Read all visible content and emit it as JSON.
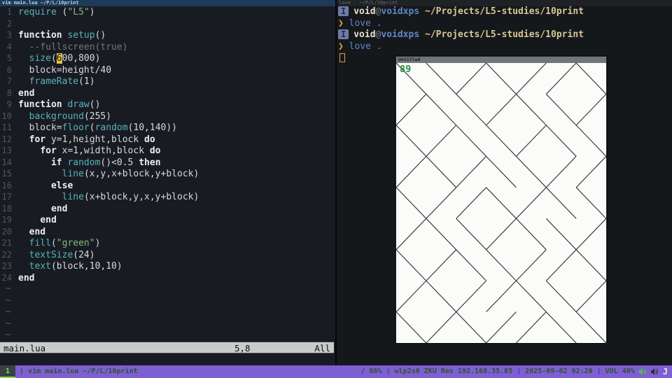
{
  "tmux": {
    "left_pane_title": "vim main.lua ~/P/L/10print",
    "right_pane_title": "love .  ~/P/L/10print",
    "status_bar": {
      "window_index": "1",
      "window_name": "| vim main.lua ~/P/L/10print",
      "right_segments": [
        {
          "text": "/ 86%",
          "sep": false
        },
        {
          "text": "|",
          "sep": true
        },
        {
          "text": "wlp2s0 ZKU Res 192.168.35.85",
          "sep": false
        },
        {
          "text": "|",
          "sep": true
        },
        {
          "text": "2025-09-02 02:20",
          "sep": false
        },
        {
          "text": "|",
          "sep": true
        },
        {
          "text": "VOL 40%",
          "sep": false
        }
      ],
      "icons": [
        "volume-on-icon",
        "volume-muted-icon"
      ],
      "logo": "J"
    }
  },
  "vim": {
    "lines": [
      {
        "n": "1",
        "seg": [
          [
            "f",
            "require"
          ],
          [
            "n",
            " ("
          ],
          [
            "s",
            "\"L5\""
          ],
          [
            "n",
            ")"
          ]
        ]
      },
      {
        "n": "2",
        "seg": []
      },
      {
        "n": "3",
        "seg": [
          [
            "k",
            "function"
          ],
          [
            "n",
            " "
          ],
          [
            "f",
            "setup"
          ],
          [
            "n",
            "()"
          ]
        ]
      },
      {
        "n": "4",
        "seg": [
          [
            "c",
            "  --fullscreen(true)"
          ]
        ]
      },
      {
        "n": "5",
        "seg": [
          [
            "n",
            "  "
          ],
          [
            "f",
            "size"
          ],
          [
            "n",
            "("
          ],
          [
            "cur",
            "6"
          ],
          [
            "n",
            "00,800)"
          ]
        ]
      },
      {
        "n": "6",
        "seg": [
          [
            "n",
            "  block=height/40"
          ]
        ]
      },
      {
        "n": "7",
        "seg": [
          [
            "n",
            "  "
          ],
          [
            "f",
            "frameRate"
          ],
          [
            "n",
            "(1)"
          ]
        ]
      },
      {
        "n": "8",
        "seg": [
          [
            "k",
            "end"
          ]
        ]
      },
      {
        "n": "9",
        "seg": [
          [
            "k",
            "function"
          ],
          [
            "n",
            " "
          ],
          [
            "f",
            "draw"
          ],
          [
            "n",
            "()"
          ]
        ]
      },
      {
        "n": "10",
        "seg": [
          [
            "n",
            "  "
          ],
          [
            "f",
            "background"
          ],
          [
            "n",
            "(255)"
          ]
        ]
      },
      {
        "n": "11",
        "seg": [
          [
            "n",
            "  block="
          ],
          [
            "f",
            "floor"
          ],
          [
            "n",
            "("
          ],
          [
            "f",
            "random"
          ],
          [
            "n",
            "(10,140))"
          ]
        ]
      },
      {
        "n": "12",
        "seg": [
          [
            "n",
            "  "
          ],
          [
            "k",
            "for"
          ],
          [
            "n",
            " y=1,height,block "
          ],
          [
            "k",
            "do"
          ]
        ]
      },
      {
        "n": "13",
        "seg": [
          [
            "n",
            "    "
          ],
          [
            "k",
            "for"
          ],
          [
            "n",
            " x=1,width,block "
          ],
          [
            "k",
            "do"
          ]
        ]
      },
      {
        "n": "14",
        "seg": [
          [
            "n",
            "      "
          ],
          [
            "k",
            "if"
          ],
          [
            "n",
            " "
          ],
          [
            "f",
            "random"
          ],
          [
            "n",
            "()<0.5 "
          ],
          [
            "k",
            "then"
          ]
        ]
      },
      {
        "n": "15",
        "seg": [
          [
            "n",
            "        "
          ],
          [
            "f",
            "line"
          ],
          [
            "n",
            "(x,y,x+block,y+block)"
          ]
        ]
      },
      {
        "n": "16",
        "seg": [
          [
            "n",
            "      "
          ],
          [
            "k",
            "else"
          ]
        ]
      },
      {
        "n": "17",
        "seg": [
          [
            "n",
            "        "
          ],
          [
            "f",
            "line"
          ],
          [
            "n",
            "(x+block,y,x,y+block)"
          ]
        ]
      },
      {
        "n": "18",
        "seg": [
          [
            "n",
            "      "
          ],
          [
            "k",
            "end"
          ]
        ]
      },
      {
        "n": "19",
        "seg": [
          [
            "n",
            "    "
          ],
          [
            "k",
            "end"
          ]
        ]
      },
      {
        "n": "20",
        "seg": [
          [
            "n",
            "  "
          ],
          [
            "k",
            "end"
          ]
        ]
      },
      {
        "n": "21",
        "seg": [
          [
            "n",
            "  "
          ],
          [
            "f",
            "fill"
          ],
          [
            "n",
            "("
          ],
          [
            "s",
            "\"green\""
          ],
          [
            "n",
            ")"
          ]
        ]
      },
      {
        "n": "22",
        "seg": [
          [
            "n",
            "  "
          ],
          [
            "f",
            "textSize"
          ],
          [
            "n",
            "(24)"
          ]
        ]
      },
      {
        "n": "23",
        "seg": [
          [
            "n",
            "  "
          ],
          [
            "f",
            "text"
          ],
          [
            "n",
            "(block,10,10)"
          ]
        ]
      },
      {
        "n": "24",
        "seg": [
          [
            "k",
            "end"
          ]
        ]
      }
    ],
    "tildes": [
      "~",
      "~",
      "~",
      "~",
      "~"
    ],
    "statusline": {
      "file": "main.lua",
      "position": "5,8",
      "scroll": "All"
    }
  },
  "terminal": {
    "rows": [
      {
        "type": "prompt",
        "badge": "I",
        "user": "void",
        "at": "@",
        "host": "voidxps",
        "path": "~/Projects/L5-studies/10print"
      },
      {
        "type": "cmd",
        "symbol": "❯",
        "command": "love ."
      },
      {
        "type": "prompt",
        "badge": "I",
        "user": "void",
        "at": "@",
        "host": "voidxps",
        "path": "~/Projects/L5-studies/10print"
      },
      {
        "type": "cmd",
        "symbol": "❯",
        "command": "love ."
      },
      {
        "type": "cursor"
      }
    ]
  },
  "window": {
    "title": "Untitled",
    "label": "89",
    "cols": 7,
    "rows": 9,
    "grid": [
      "0010110",
      "1001001",
      "0100100",
      "1010011",
      "0110100",
      "1001001",
      "0100110",
      "1011001",
      "0101100"
    ],
    "line_color": "#3d3d3d",
    "bg_color": "#fbfbfa",
    "label_color": "#2c8c3c"
  }
}
